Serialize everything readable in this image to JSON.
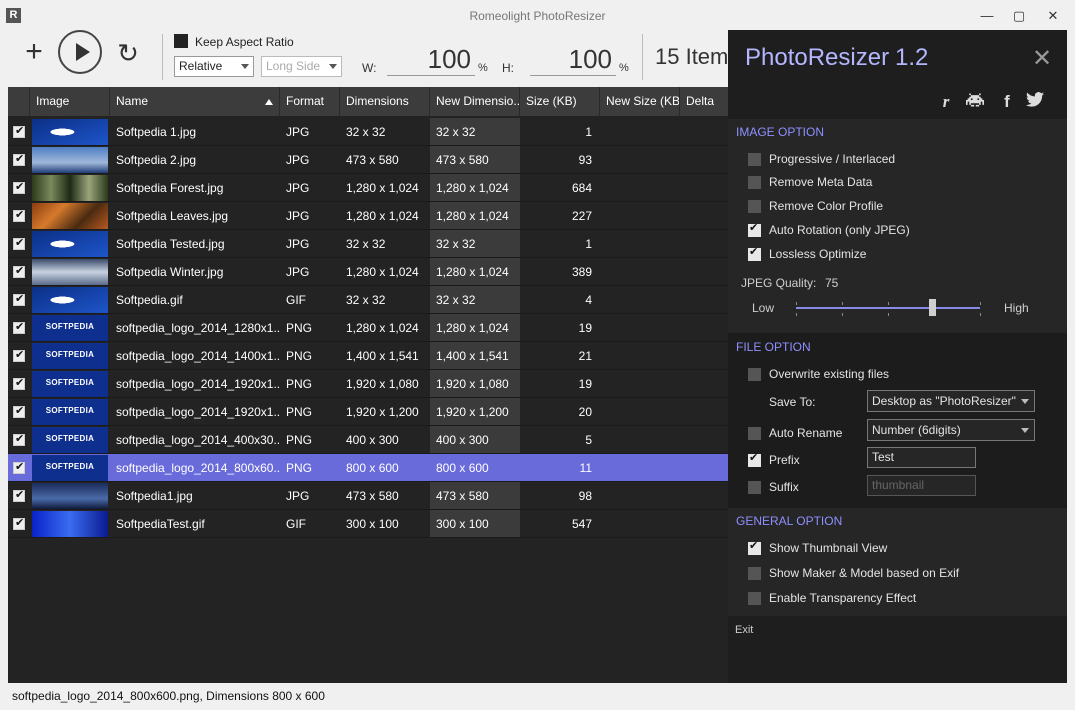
{
  "window": {
    "title": "Romeolight PhotoResizer",
    "app_icon": "R",
    "minimize_icon": "—",
    "maximize_icon": "▢",
    "close_icon": "✕"
  },
  "toolbar": {
    "add_icon": "+",
    "refresh_icon": "↻",
    "keep_aspect_label": "Keep Aspect Ratio",
    "keep_aspect_checked": false,
    "mode_value": "Relative",
    "side_value": "Long Side",
    "w_label": "W:",
    "w_value": "100",
    "w_unit": "%",
    "h_label": "H:",
    "h_value": "100",
    "h_unit": "%",
    "items_count": "15 Item"
  },
  "grid": {
    "columns": [
      "Image",
      "Name",
      "Format",
      "Dimensions",
      "New Dimensio...",
      "Size (KB)",
      "New Size (KB)",
      "Delta"
    ],
    "sort_column": "Name",
    "rows": [
      {
        "name": "Softpedia 1.jpg",
        "format": "JPG",
        "dims": "32 x 32",
        "new_dims": "32 x 32",
        "size": "1",
        "thumb_text": "",
        "selected": false
      },
      {
        "name": "Softpedia 2.jpg",
        "format": "JPG",
        "dims": "473 x 580",
        "new_dims": "473 x 580",
        "size": "93",
        "thumb_text": "",
        "selected": false
      },
      {
        "name": "Softpedia Forest.jpg",
        "format": "JPG",
        "dims": "1,280 x 1,024",
        "new_dims": "1,280 x 1,024",
        "size": "684",
        "thumb_text": "",
        "selected": false
      },
      {
        "name": "Softpedia Leaves.jpg",
        "format": "JPG",
        "dims": "1,280 x 1,024",
        "new_dims": "1,280 x 1,024",
        "size": "227",
        "thumb_text": "",
        "selected": false
      },
      {
        "name": "Softpedia Tested.jpg",
        "format": "JPG",
        "dims": "32 x 32",
        "new_dims": "32 x 32",
        "size": "1",
        "thumb_text": "",
        "selected": false
      },
      {
        "name": "Softpedia Winter.jpg",
        "format": "JPG",
        "dims": "1,280 x 1,024",
        "new_dims": "1,280 x 1,024",
        "size": "389",
        "thumb_text": "",
        "selected": false
      },
      {
        "name": "Softpedia.gif",
        "format": "GIF",
        "dims": "32 x 32",
        "new_dims": "32 x 32",
        "size": "4",
        "thumb_text": "",
        "selected": false
      },
      {
        "name": "softpedia_logo_2014_1280x1...",
        "format": "PNG",
        "dims": "1,280 x 1,024",
        "new_dims": "1,280 x 1,024",
        "size": "19",
        "thumb_text": "SOFTPEDIA",
        "selected": false
      },
      {
        "name": "softpedia_logo_2014_1400x1...",
        "format": "PNG",
        "dims": "1,400 x 1,541",
        "new_dims": "1,400 x 1,541",
        "size": "21",
        "thumb_text": "SOFTPEDIA",
        "selected": false
      },
      {
        "name": "softpedia_logo_2014_1920x1...",
        "format": "PNG",
        "dims": "1,920 x 1,080",
        "new_dims": "1,920 x 1,080",
        "size": "19",
        "thumb_text": "SOFTPEDIA",
        "selected": false
      },
      {
        "name": "softpedia_logo_2014_1920x1...",
        "format": "PNG",
        "dims": "1,920 x 1,200",
        "new_dims": "1,920 x 1,200",
        "size": "20",
        "thumb_text": "SOFTPEDIA",
        "selected": false
      },
      {
        "name": "softpedia_logo_2014_400x30...",
        "format": "PNG",
        "dims": "400 x 300",
        "new_dims": "400 x 300",
        "size": "5",
        "thumb_text": "SOFTPEDIA",
        "selected": false
      },
      {
        "name": "softpedia_logo_2014_800x60...",
        "format": "PNG",
        "dims": "800 x 600",
        "new_dims": "800 x 600",
        "size": "11",
        "thumb_text": "SOFTPEDIA",
        "selected": true
      },
      {
        "name": "Softpedia1.jpg",
        "format": "JPG",
        "dims": "473 x 580",
        "new_dims": "473 x 580",
        "size": "98",
        "thumb_text": "",
        "selected": false
      },
      {
        "name": "SoftpediaTest.gif",
        "format": "GIF",
        "dims": "300 x 100",
        "new_dims": "300 x 100",
        "size": "547",
        "thumb_text": "",
        "selected": false
      }
    ]
  },
  "panel": {
    "title": "PhotoResizer",
    "version": "1.2",
    "close_icon": "✕",
    "social_icons": [
      "romeolight-icon",
      "invader-icon",
      "facebook-icon",
      "twitter-icon"
    ],
    "image_option": {
      "heading": "IMAGE OPTION",
      "options": [
        {
          "label": "Progressive / Interlaced",
          "checked": false
        },
        {
          "label": "Remove Meta Data",
          "checked": false
        },
        {
          "label": "Remove Color Profile",
          "checked": false
        },
        {
          "label": "Auto Rotation (only JPEG)",
          "checked": true
        },
        {
          "label": "Lossless Optimize",
          "checked": true
        }
      ],
      "jpeg_quality_label": "JPEG Quality:",
      "jpeg_quality_value": "75",
      "low_label": "Low",
      "high_label": "High"
    },
    "file_option": {
      "heading": "FILE OPTION",
      "overwrite_label": "Overwrite existing files",
      "save_to_label": "Save To:",
      "save_to_value": "Desktop as \"PhotoResizer\"",
      "auto_rename_label": "Auto Rename",
      "auto_rename_value": "Number (6digits)",
      "prefix_label": "Prefix",
      "prefix_value": "Test",
      "suffix_label": "Suffix",
      "suffix_placeholder": "thumbnail"
    },
    "general_option": {
      "heading": "GENERAL OPTION",
      "options": [
        {
          "label": "Show Thumbnail View",
          "checked": true
        },
        {
          "label": "Show Maker & Model based on Exif",
          "checked": false
        },
        {
          "label": "Enable Transparency Effect",
          "checked": false
        }
      ]
    },
    "exit_label": "Exit"
  },
  "status": {
    "text": "softpedia_logo_2014_800x600.png, Dimensions 800 x 600"
  },
  "colors": {
    "accent": "#6a6bda",
    "panel_heading": "#8e90ff",
    "grid_bg": "#232323"
  }
}
